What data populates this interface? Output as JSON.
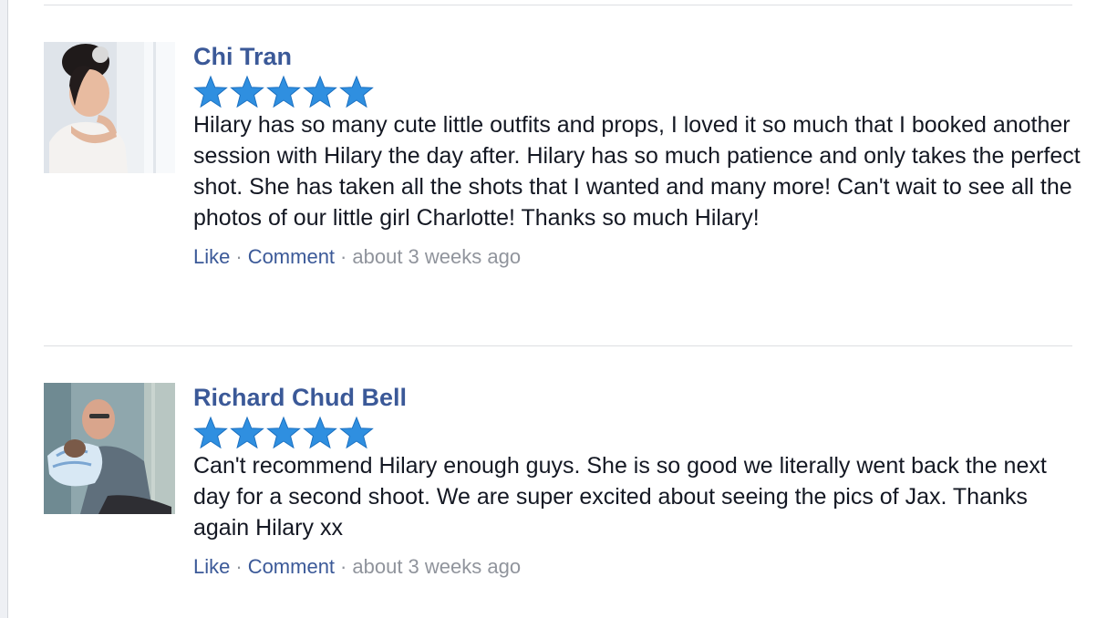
{
  "colors": {
    "link": "#3b5998",
    "muted": "#90949c",
    "star": "#2f8fe0",
    "divider": "#dddfe2"
  },
  "reviews": [
    {
      "name": "Chi Tran",
      "rating": 5,
      "text": "Hilary has so many cute little outfits and props, I loved it so much that I booked another session with Hilary the day after. Hilary has so much patience and only takes the perfect shot. She has taken all the shots that I wanted and many more! Can't wait to see all the photos of our little girl Charlotte! Thanks so much Hilary!",
      "like_label": "Like",
      "comment_label": "Comment",
      "time": "about 3 weeks ago"
    },
    {
      "name": "Richard Chud Bell",
      "rating": 5,
      "text": "Can't recommend Hilary enough guys. She is so good we literally went back the next day for a second shoot. We are super excited about seeing the pics of Jax. Thanks again Hilary xx",
      "like_label": "Like",
      "comment_label": "Comment",
      "time": "about 3 weeks ago"
    }
  ]
}
